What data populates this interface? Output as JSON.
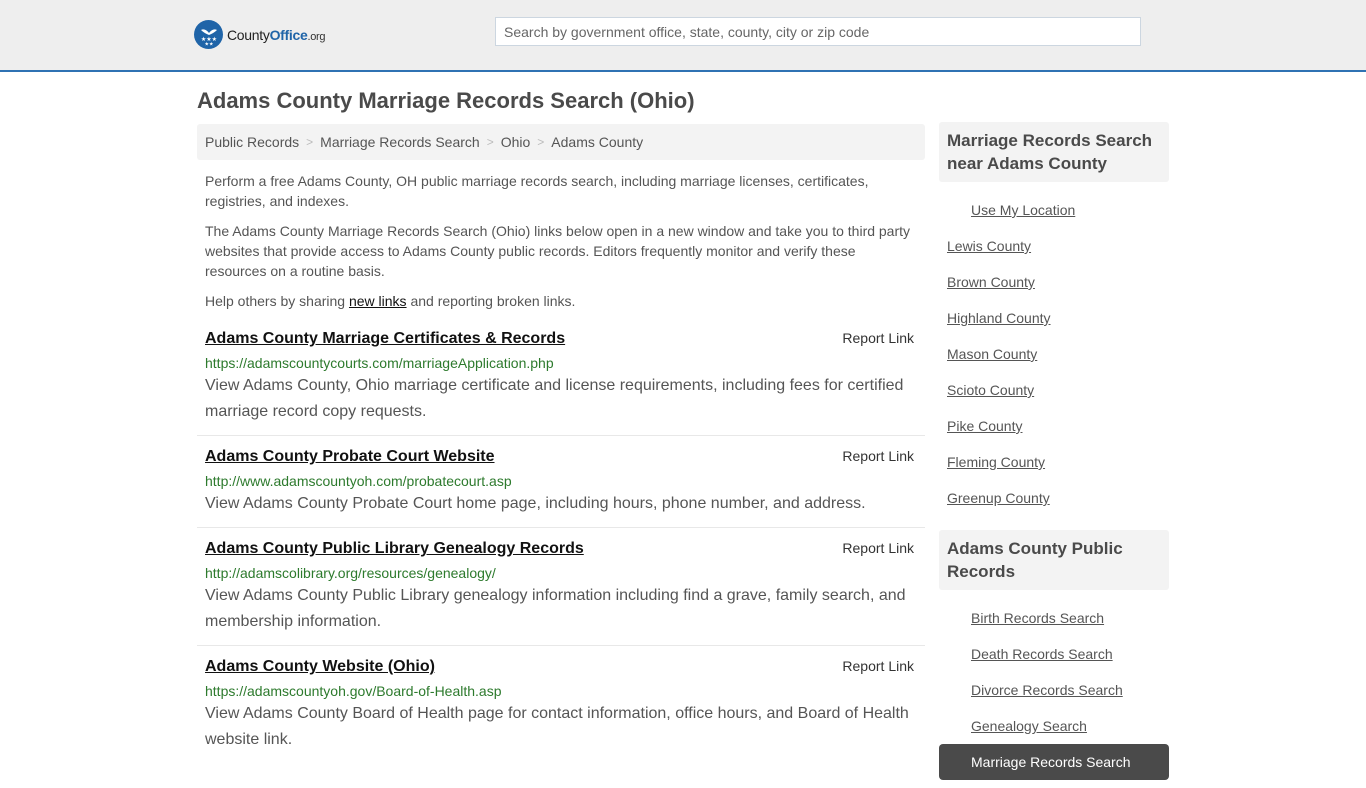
{
  "header": {
    "logo": {
      "county": "County",
      "office": "Office",
      "tld": ".org",
      "icon": "eagle-stars-icon"
    },
    "search": {
      "placeholder": "Search by government office, state, county, city or zip code",
      "value": ""
    },
    "accent_color": "#2f72b3"
  },
  "page_title": "Adams County Marriage Records Search (Ohio)",
  "breadcrumb": [
    {
      "label": "Public Records"
    },
    {
      "label": "Marriage Records Search"
    },
    {
      "label": "Ohio"
    },
    {
      "label": "Adams County"
    }
  ],
  "breadcrumb_separator": ">",
  "intro": {
    "p1": "Perform a free Adams County, OH public marriage records search, including marriage licenses, certificates, registries, and indexes.",
    "p2": "The Adams County Marriage Records Search (Ohio) links below open in a new window and take you to third party websites that provide access to Adams County public records. Editors frequently monitor and verify these resources on a routine basis.",
    "p3_before": "Help others by sharing ",
    "p3_link": "new links",
    "p3_after": " and reporting broken links."
  },
  "results": [
    {
      "title": "Adams County Marriage Certificates & Records",
      "url": "https://adamscountycourts.com/marriageApplication.php",
      "description": "View Adams County, Ohio marriage certificate and license requirements, including fees for certified marriage record copy requests.",
      "report_label": "Report Link"
    },
    {
      "title": "Adams County Probate Court Website",
      "url": "http://www.adamscountyoh.com/probatecourt.asp",
      "description": "View Adams County Probate Court home page, including hours, phone number, and address.",
      "report_label": "Report Link"
    },
    {
      "title": "Adams County Public Library Genealogy Records",
      "url": "http://adamscolibrary.org/resources/genealogy/",
      "description": "View Adams County Public Library genealogy information including find a grave, family search, and membership information.",
      "report_label": "Report Link"
    },
    {
      "title": "Adams County Website (Ohio)",
      "url": "https://adamscountyoh.gov/Board-of-Health.asp",
      "description": "View Adams County Board of Health page for contact information, office hours, and Board of Health website link.",
      "report_label": "Report Link"
    }
  ],
  "sidebar": {
    "nearby": {
      "heading": "Marriage Records Search near Adams County",
      "use_location": "Use My Location",
      "counties": [
        "Lewis County",
        "Brown County",
        "Highland County",
        "Mason County",
        "Scioto County",
        "Pike County",
        "Fleming County",
        "Greenup County"
      ]
    },
    "public_records": {
      "heading": "Adams County Public Records",
      "items": [
        {
          "label": "Birth Records Search",
          "active": false
        },
        {
          "label": "Death Records Search",
          "active": false
        },
        {
          "label": "Divorce Records Search",
          "active": false
        },
        {
          "label": "Genealogy Search",
          "active": false
        },
        {
          "label": "Marriage Records Search",
          "active": true
        }
      ]
    }
  }
}
